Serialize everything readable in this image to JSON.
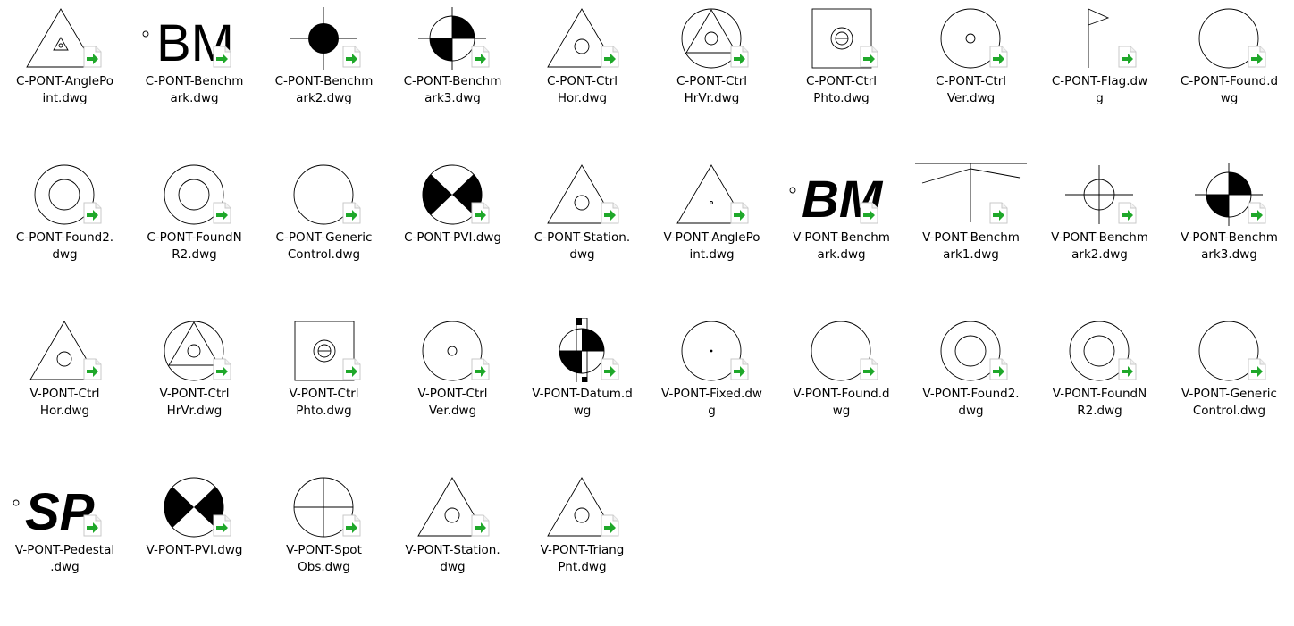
{
  "files": [
    {
      "label": "C-PONT-AnglePo\nint.dwg",
      "icon": "triangle-with-small-triangle-icon"
    },
    {
      "label": "C-PONT-Benchm\nark.dwg",
      "icon": "bm-text-icon"
    },
    {
      "label": "C-PONT-Benchm\nark2.dwg",
      "icon": "filled-circle-crosshair-icon"
    },
    {
      "label": "C-PONT-Benchm\nark3.dwg",
      "icon": "quartered-circle-crosshair-icon"
    },
    {
      "label": "C-PONT-Ctrl\nHor.dwg",
      "icon": "triangle-with-circle-icon"
    },
    {
      "label": "C-PONT-Ctrl\nHrVr.dwg",
      "icon": "circle-triangle-circle-icon"
    },
    {
      "label": "C-PONT-Ctrl\nPhto.dwg",
      "icon": "square-with-theta-icon"
    },
    {
      "label": "C-PONT-Ctrl\nVer.dwg",
      "icon": "circle-with-small-circle-icon"
    },
    {
      "label": "C-PONT-Flag.dw\ng",
      "icon": "flag-icon"
    },
    {
      "label": "C-PONT-Found.d\nwg",
      "icon": "circle-icon"
    },
    {
      "label": "C-PONT-Found2.\ndwg",
      "icon": "double-circle-icon"
    },
    {
      "label": "C-PONT-FoundN\nR2.dwg",
      "icon": "double-circle-icon"
    },
    {
      "label": "C-PONT-Generic\nControl.dwg",
      "icon": "circle-icon"
    },
    {
      "label": "C-PONT-PVI.dwg",
      "icon": "bowtie-circle-icon"
    },
    {
      "label": "C-PONT-Station.\ndwg",
      "icon": "triangle-with-circle-icon"
    },
    {
      "label": "V-PONT-AnglePo\nint.dwg",
      "icon": "triangle-with-dot-icon"
    },
    {
      "label": "V-PONT-Benchm\nark.dwg",
      "icon": "bm-italic-text-icon"
    },
    {
      "label": "V-PONT-Benchm\nark1.dwg",
      "icon": "t-bar-icon"
    },
    {
      "label": "V-PONT-Benchm\nark2.dwg",
      "icon": "crosshair-circle-icon"
    },
    {
      "label": "V-PONT-Benchm\nark3.dwg",
      "icon": "quartered-circle-crosshair-icon"
    },
    {
      "label": "V-PONT-Ctrl\nHor.dwg",
      "icon": "triangle-with-circle-icon"
    },
    {
      "label": "V-PONT-Ctrl\nHrVr.dwg",
      "icon": "circle-triangle-circle-icon"
    },
    {
      "label": "V-PONT-Ctrl\nPhto.dwg",
      "icon": "square-with-theta-icon"
    },
    {
      "label": "V-PONT-Ctrl\nVer.dwg",
      "icon": "circle-with-small-circle-icon"
    },
    {
      "label": "V-PONT-Datum.d\nwg",
      "icon": "datum-quartered-icon"
    },
    {
      "label": "V-PONT-Fixed.dw\ng",
      "icon": "circle-with-dot-icon"
    },
    {
      "label": "V-PONT-Found.d\nwg",
      "icon": "circle-icon"
    },
    {
      "label": "V-PONT-Found2.\ndwg",
      "icon": "double-circle-icon"
    },
    {
      "label": "V-PONT-FoundN\nR2.dwg",
      "icon": "double-circle-icon"
    },
    {
      "label": "V-PONT-Generic\nControl.dwg",
      "icon": "circle-icon"
    },
    {
      "label": "V-PONT-Pedestal\n.dwg",
      "icon": "sp-italic-text-icon"
    },
    {
      "label": "V-PONT-PVI.dwg",
      "icon": "bowtie-circle-icon"
    },
    {
      "label": "V-PONT-Spot\nObs.dwg",
      "icon": "circle-cross-icon"
    },
    {
      "label": "V-PONT-Station.\ndwg",
      "icon": "triangle-with-circle-icon"
    },
    {
      "label": "V-PONT-Triang\nPnt.dwg",
      "icon": "triangle-with-circle-icon"
    }
  ],
  "badge_icon": "shortcut-arrow-icon",
  "colors": {
    "badge_arrow": "#1fa82a",
    "stroke": "#000000",
    "background": "#ffffff"
  }
}
